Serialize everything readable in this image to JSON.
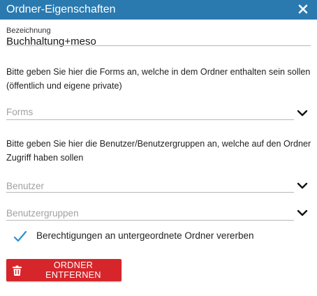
{
  "dialog": {
    "title": "Ordner-Eigenschaften",
    "close_icon": "close-icon"
  },
  "name_field": {
    "label": "Bezeichnung",
    "value": "Buchhaltung+meso"
  },
  "forms_section": {
    "description": "Bitte geben Sie hier die Forms an, welche in dem Ordner enthalten sein sollen (öffentlich und eigene private)",
    "select_placeholder": "Forms"
  },
  "users_section": {
    "description": "Bitte geben Sie hier die Benutzer/Benutzergruppen an, welche auf den Ordner Zugriff haben sollen",
    "users_placeholder": "Benutzer",
    "groups_placeholder": "Benutzergruppen"
  },
  "inherit_option": {
    "label": "Berechtigungen an untergeordnete Ordner vererben",
    "checked": true
  },
  "remove_button": {
    "label": "ORDNER ENTFERNEN",
    "icon": "trash-icon"
  },
  "colors": {
    "titlebar": "#2a7ab0",
    "accent": "#2a8fd6",
    "danger": "#d6262b",
    "placeholder": "#a0a0a0"
  }
}
